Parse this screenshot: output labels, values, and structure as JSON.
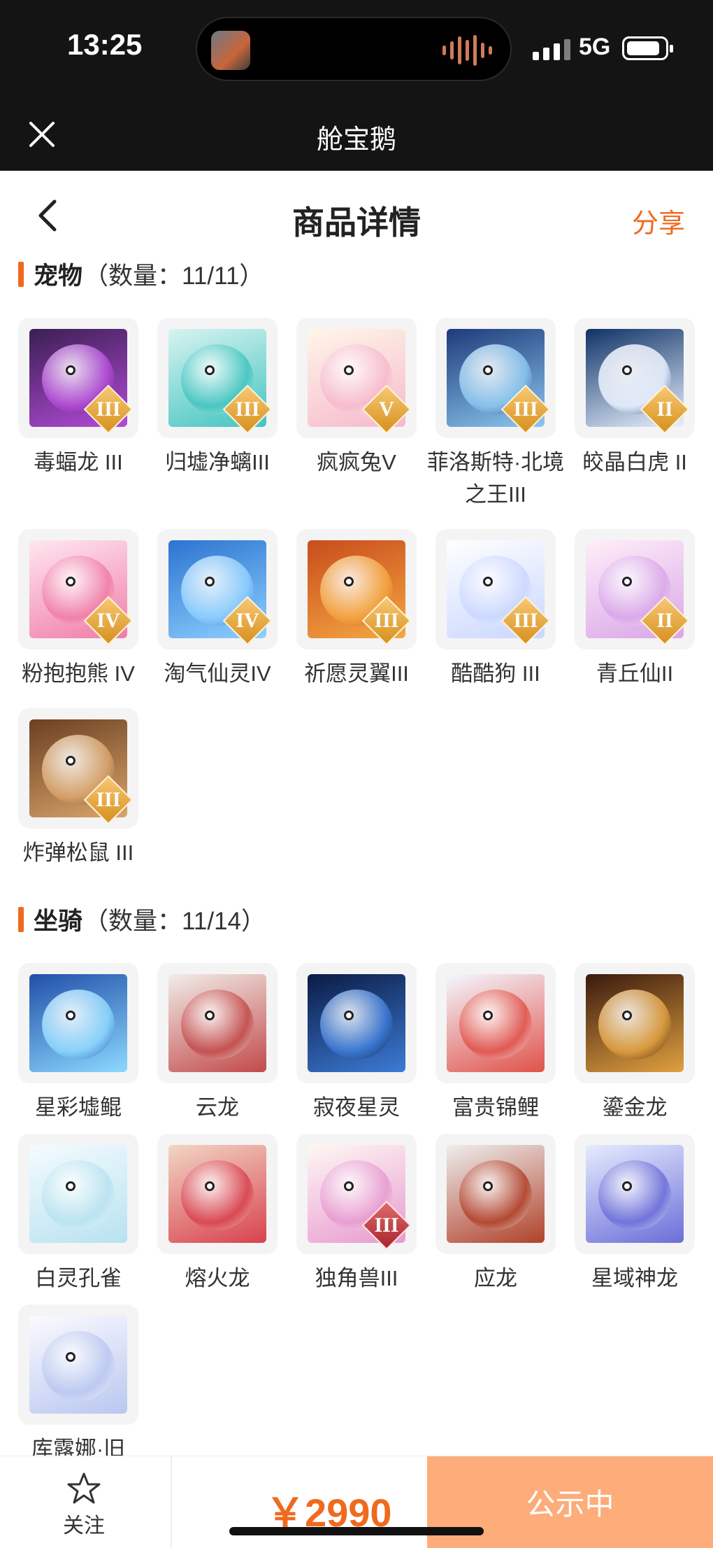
{
  "status_bar": {
    "time": "13:25",
    "network": "5G"
  },
  "app_bar": {
    "title": "舱宝鹅"
  },
  "page": {
    "title": "商品详情",
    "share_label": "分享"
  },
  "colors": {
    "accent": "#f06a1e",
    "status_button": "#fdac7a",
    "app_bar_bg": "#141414"
  },
  "sections": [
    {
      "name": "宠物",
      "count": "（数量：11/11）",
      "items": [
        {
          "name": "毒蝠龙 III",
          "tier": "III",
          "icon": "pet-poison-bat-dragon-icon"
        },
        {
          "name": "归墟净螭III",
          "tier": "III",
          "icon": "pet-cyan-dragon-icon"
        },
        {
          "name": "疯疯兔V",
          "tier": "V",
          "icon": "pet-pink-rabbit-icon"
        },
        {
          "name": "菲洛斯特·北境之王III",
          "tier": "III",
          "icon": "pet-ice-king-icon"
        },
        {
          "name": "皎晶白虎 II",
          "tier": "II",
          "icon": "pet-white-tiger-icon"
        },
        {
          "name": "粉抱抱熊 IV",
          "tier": "IV",
          "icon": "pet-pink-bear-icon"
        },
        {
          "name": "淘气仙灵IV",
          "tier": "IV",
          "icon": "pet-blue-puppy-icon"
        },
        {
          "name": "祈愿灵翼III",
          "tier": "III",
          "icon": "pet-fire-bird-icon"
        },
        {
          "name": "酷酷狗 III",
          "tier": "III",
          "icon": "pet-cool-dog-icon"
        },
        {
          "name": "青丘仙II",
          "tier": "II",
          "icon": "pet-fox-fairy-icon"
        },
        {
          "name": "炸弹松鼠 III",
          "tier": "III",
          "icon": "pet-bomb-squirrel-icon"
        }
      ]
    },
    {
      "name": "坐骑",
      "count": "（数量：11/14）",
      "items": [
        {
          "name": "星彩墟鲲",
          "tier": "",
          "icon": "mount-star-whale-icon"
        },
        {
          "name": "云龙",
          "tier": "",
          "icon": "mount-cloud-dragon-icon"
        },
        {
          "name": "寂夜星灵",
          "tier": "",
          "icon": "mount-night-spirit-icon"
        },
        {
          "name": "富贵锦鲤",
          "tier": "",
          "icon": "mount-koi-icon"
        },
        {
          "name": "鎏金龙",
          "tier": "",
          "icon": "mount-gold-dragon-icon"
        },
        {
          "name": "白灵孔雀",
          "tier": "",
          "icon": "mount-white-peacock-icon"
        },
        {
          "name": "熔火龙",
          "tier": "",
          "icon": "mount-lava-dragon-icon"
        },
        {
          "name": "独角兽III",
          "tier": "III",
          "icon": "mount-unicorn-icon"
        },
        {
          "name": "应龙",
          "tier": "",
          "icon": "mount-ying-dragon-icon"
        },
        {
          "name": "星域神龙",
          "tier": "",
          "icon": "mount-star-dragon-icon"
        },
        {
          "name": "库露娜·旧",
          "tier": "",
          "icon": "mount-kuluna-icon"
        }
      ]
    }
  ],
  "bottom_bar": {
    "favorite_label": "关注",
    "price": "￥2990",
    "status_button_label": "公示中"
  }
}
